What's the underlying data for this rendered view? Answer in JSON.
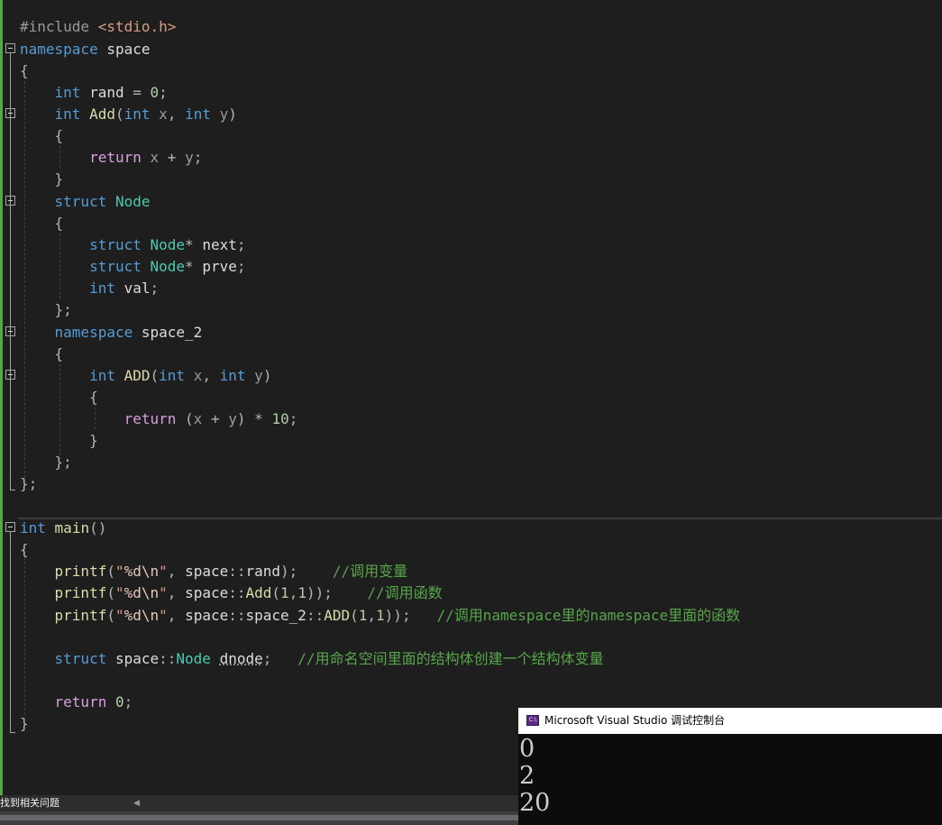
{
  "editor": {
    "lines": [
      {
        "text": "#include <stdio.h>"
      },
      {
        "text": "namespace space"
      },
      {
        "text": "{"
      },
      {
        "text": "    int rand = 0;"
      },
      {
        "text": "    int Add(int x, int y)"
      },
      {
        "text": "    {"
      },
      {
        "text": "        return x + y;"
      },
      {
        "text": "    }"
      },
      {
        "text": "    struct Node"
      },
      {
        "text": "    {"
      },
      {
        "text": "        struct Node* next;"
      },
      {
        "text": "        struct Node* prve;"
      },
      {
        "text": "        int val;"
      },
      {
        "text": "    };"
      },
      {
        "text": "    namespace space_2"
      },
      {
        "text": "    {"
      },
      {
        "text": "        int ADD(int x, int y)"
      },
      {
        "text": "        {"
      },
      {
        "text": "            return (x + y) * 10;"
      },
      {
        "text": "        }"
      },
      {
        "text": "    };"
      },
      {
        "text": "};"
      },
      {
        "text": ""
      },
      {
        "text": "int main()"
      },
      {
        "text": "{"
      },
      {
        "text": "    printf(\"%d\\n\", space::rand);    //调用变量"
      },
      {
        "text": "    printf(\"%d\\n\", space::Add(1,1));    //调用函数"
      },
      {
        "text": "    printf(\"%d\\n\", space::space_2::ADD(1,1));   //调用namespace里的namespace里面的函数"
      },
      {
        "text": ""
      },
      {
        "text": "    struct space::Node dnode;   //用命名空间里面的结构体创建一个结构体变量"
      },
      {
        "text": ""
      },
      {
        "text": "    return 0;"
      },
      {
        "text": "}"
      }
    ]
  },
  "statusbar": {
    "find_related": "找到相关问题"
  },
  "console": {
    "title": "Microsoft Visual Studio 调试控制台",
    "icon_label": "C:\\",
    "output": [
      "0",
      "2",
      "20"
    ]
  },
  "colors": {
    "background": "#1e1e1e",
    "keyword": "#569cd6",
    "control": "#d8a0df",
    "type": "#4ec9b0",
    "function": "#dcdcaa",
    "comment": "#57a64a",
    "string": "#d69d85",
    "number": "#b5cea8",
    "console_bg": "#0c0c0c"
  }
}
